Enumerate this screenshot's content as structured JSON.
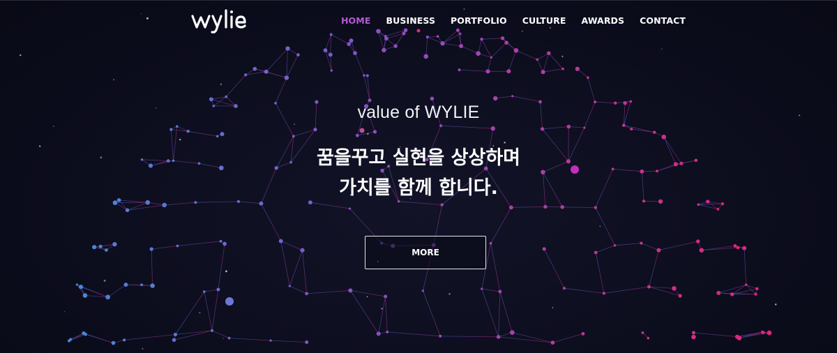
{
  "brand": {
    "logo_text": "wylie"
  },
  "nav": {
    "items": [
      {
        "label": "HOME",
        "active": true
      },
      {
        "label": "BUSINESS",
        "active": false
      },
      {
        "label": "PORTFOLIO",
        "active": false
      },
      {
        "label": "CULTURE",
        "active": false
      },
      {
        "label": "AWARDS",
        "active": false
      },
      {
        "label": "CONTACT",
        "active": false
      }
    ],
    "active_color": "#b45ad2"
  },
  "hero": {
    "subtitle": "value of WYLIE",
    "headline_line1": "꿈을꾸고 실현을 상상하며",
    "headline_line2": "가치를 함께 합니다.",
    "cta_label": "MORE"
  },
  "theme": {
    "background": "#0c0d1d",
    "network_cool": "#4a86d8",
    "network_mid": "#8a4fc4",
    "network_warm": "#e0267a"
  }
}
